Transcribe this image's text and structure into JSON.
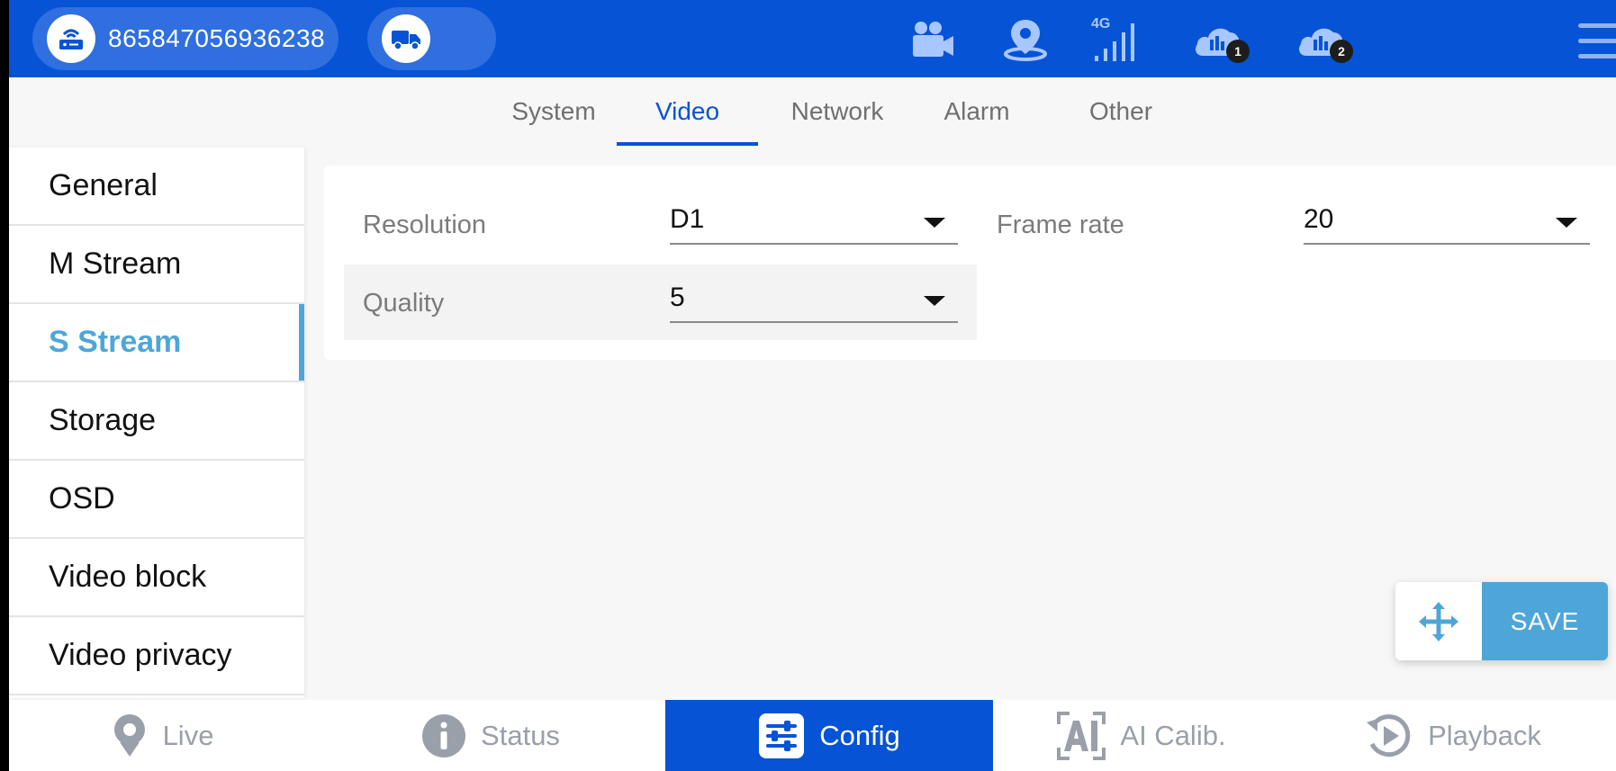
{
  "header": {
    "device_id": "865847056936238",
    "status_icons": [
      {
        "icon": "camera-icon"
      },
      {
        "icon": "gps-location-icon"
      },
      {
        "icon": "signal-4g-icon",
        "label": "4G"
      },
      {
        "icon": "cloud-server-icon",
        "badge": "1"
      },
      {
        "icon": "cloud-server-icon",
        "badge": "2"
      }
    ]
  },
  "tabs": [
    {
      "label": "System",
      "active": false
    },
    {
      "label": "Video",
      "active": true
    },
    {
      "label": "Network",
      "active": false
    },
    {
      "label": "Alarm",
      "active": false
    },
    {
      "label": "Other",
      "active": false
    }
  ],
  "sidebar": {
    "items": [
      {
        "label": "General",
        "active": false
      },
      {
        "label": "M Stream",
        "active": false
      },
      {
        "label": "S Stream",
        "active": true
      },
      {
        "label": "Storage",
        "active": false
      },
      {
        "label": "OSD",
        "active": false
      },
      {
        "label": "Video block",
        "active": false
      },
      {
        "label": "Video privacy",
        "active": false
      }
    ]
  },
  "form": {
    "resolution": {
      "label": "Resolution",
      "value": "D1"
    },
    "frame_rate": {
      "label": "Frame rate",
      "value": "20"
    },
    "quality": {
      "label": "Quality",
      "value": "5"
    }
  },
  "actions": {
    "save_label": "SAVE"
  },
  "bottom_nav": [
    {
      "label": "Live",
      "icon": "live-pin-icon",
      "active": false
    },
    {
      "label": "Status",
      "icon": "info-icon",
      "active": false
    },
    {
      "label": "Config",
      "icon": "config-sliders-icon",
      "active": true
    },
    {
      "label": "AI Calib.",
      "icon": "ai-icon",
      "active": false
    },
    {
      "label": "Playback",
      "icon": "playback-icon",
      "active": false
    }
  ],
  "colors": {
    "primary": "#0653d6",
    "accent": "#4ea6d8",
    "background": "#f7f7f7"
  }
}
